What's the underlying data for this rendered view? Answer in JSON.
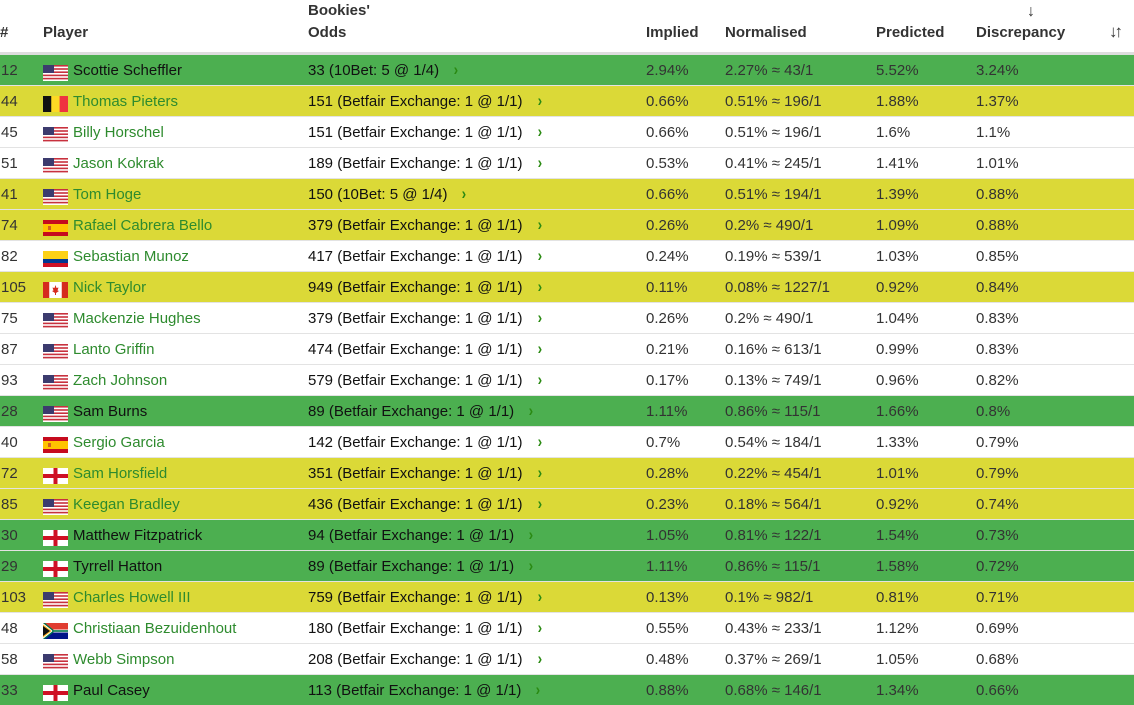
{
  "table": {
    "headers": {
      "rank": "#",
      "player": "Player",
      "odds_line1": "Bookies'",
      "odds_line2": "Odds",
      "implied": "Implied",
      "normalised": "Normalised",
      "predicted": "Predicted",
      "discrepancy": "Discrepancy",
      "sort_active_icon": "↓",
      "sort_toggle_icon": "↓↑"
    },
    "colors": {
      "green_row": "#4caf50",
      "yellow_row": "#dbd937",
      "white_row": "#ffffff",
      "link": "#2e8b2e",
      "chevron": "#2a8a12"
    },
    "chevron_icon": "›",
    "rows": [
      {
        "rank": "12",
        "flag": "usa",
        "player": "Scottie Scheffler",
        "odds": "33 (10Bet: 5 @ 1/4)",
        "implied": "2.94%",
        "normalised": "2.27% ≈ 43/1",
        "predicted": "5.52%",
        "discrepancy": "3.24%",
        "highlight": "green"
      },
      {
        "rank": "44",
        "flag": "belgium",
        "player": "Thomas Pieters",
        "odds": "151 (Betfair Exchange: 1 @ 1/1)",
        "implied": "0.66%",
        "normalised": "0.51% ≈ 196/1",
        "predicted": "1.88%",
        "discrepancy": "1.37%",
        "highlight": "yellow"
      },
      {
        "rank": "45",
        "flag": "usa",
        "player": "Billy Horschel",
        "odds": "151 (Betfair Exchange: 1 @ 1/1)",
        "implied": "0.66%",
        "normalised": "0.51% ≈ 196/1",
        "predicted": "1.6%",
        "discrepancy": "1.1%",
        "highlight": "white"
      },
      {
        "rank": "51",
        "flag": "usa",
        "player": "Jason Kokrak",
        "odds": "189 (Betfair Exchange: 1 @ 1/1)",
        "implied": "0.53%",
        "normalised": "0.41% ≈ 245/1",
        "predicted": "1.41%",
        "discrepancy": "1.01%",
        "highlight": "white"
      },
      {
        "rank": "41",
        "flag": "usa",
        "player": "Tom Hoge",
        "odds": "150 (10Bet: 5 @ 1/4)",
        "implied": "0.66%",
        "normalised": "0.51% ≈ 194/1",
        "predicted": "1.39%",
        "discrepancy": "0.88%",
        "highlight": "yellow"
      },
      {
        "rank": "74",
        "flag": "spain",
        "player": "Rafael Cabrera Bello",
        "odds": "379 (Betfair Exchange: 1 @ 1/1)",
        "implied": "0.26%",
        "normalised": "0.2% ≈ 490/1",
        "predicted": "1.09%",
        "discrepancy": "0.88%",
        "highlight": "yellow"
      },
      {
        "rank": "82",
        "flag": "colombia",
        "player": "Sebastian Munoz",
        "odds": "417 (Betfair Exchange: 1 @ 1/1)",
        "implied": "0.24%",
        "normalised": "0.19% ≈ 539/1",
        "predicted": "1.03%",
        "discrepancy": "0.85%",
        "highlight": "white"
      },
      {
        "rank": "105",
        "flag": "canada",
        "player": "Nick Taylor",
        "odds": "949 (Betfair Exchange: 1 @ 1/1)",
        "implied": "0.11%",
        "normalised": "0.08% ≈ 1227/1",
        "predicted": "0.92%",
        "discrepancy": "0.84%",
        "highlight": "yellow"
      },
      {
        "rank": "75",
        "flag": "usa",
        "player": "Mackenzie Hughes",
        "odds": "379 (Betfair Exchange: 1 @ 1/1)",
        "implied": "0.26%",
        "normalised": "0.2% ≈ 490/1",
        "predicted": "1.04%",
        "discrepancy": "0.83%",
        "highlight": "white"
      },
      {
        "rank": "87",
        "flag": "usa",
        "player": "Lanto Griffin",
        "odds": "474 (Betfair Exchange: 1 @ 1/1)",
        "implied": "0.21%",
        "normalised": "0.16% ≈ 613/1",
        "predicted": "0.99%",
        "discrepancy": "0.83%",
        "highlight": "white"
      },
      {
        "rank": "93",
        "flag": "usa",
        "player": "Zach Johnson",
        "odds": "579 (Betfair Exchange: 1 @ 1/1)",
        "implied": "0.17%",
        "normalised": "0.13% ≈ 749/1",
        "predicted": "0.96%",
        "discrepancy": "0.82%",
        "highlight": "white"
      },
      {
        "rank": "28",
        "flag": "usa",
        "player": "Sam Burns",
        "odds": "89 (Betfair Exchange: 1 @ 1/1)",
        "implied": "1.11%",
        "normalised": "0.86% ≈ 115/1",
        "predicted": "1.66%",
        "discrepancy": "0.8%",
        "highlight": "green"
      },
      {
        "rank": "40",
        "flag": "spain",
        "player": "Sergio Garcia",
        "odds": "142 (Betfair Exchange: 1 @ 1/1)",
        "implied": "0.7%",
        "normalised": "0.54% ≈ 184/1",
        "predicted": "1.33%",
        "discrepancy": "0.79%",
        "highlight": "white"
      },
      {
        "rank": "72",
        "flag": "england",
        "player": "Sam Horsfield",
        "odds": "351 (Betfair Exchange: 1 @ 1/1)",
        "implied": "0.28%",
        "normalised": "0.22% ≈ 454/1",
        "predicted": "1.01%",
        "discrepancy": "0.79%",
        "highlight": "yellow"
      },
      {
        "rank": "85",
        "flag": "usa",
        "player": "Keegan Bradley",
        "odds": "436 (Betfair Exchange: 1 @ 1/1)",
        "implied": "0.23%",
        "normalised": "0.18% ≈ 564/1",
        "predicted": "0.92%",
        "discrepancy": "0.74%",
        "highlight": "yellow"
      },
      {
        "rank": "30",
        "flag": "england",
        "player": "Matthew Fitzpatrick",
        "odds": "94 (Betfair Exchange: 1 @ 1/1)",
        "implied": "1.05%",
        "normalised": "0.81% ≈ 122/1",
        "predicted": "1.54%",
        "discrepancy": "0.73%",
        "highlight": "green"
      },
      {
        "rank": "29",
        "flag": "england",
        "player": "Tyrrell Hatton",
        "odds": "89 (Betfair Exchange: 1 @ 1/1)",
        "implied": "1.11%",
        "normalised": "0.86% ≈ 115/1",
        "predicted": "1.58%",
        "discrepancy": "0.72%",
        "highlight": "green"
      },
      {
        "rank": "103",
        "flag": "usa",
        "player": "Charles Howell III",
        "odds": "759 (Betfair Exchange: 1 @ 1/1)",
        "implied": "0.13%",
        "normalised": "0.1% ≈ 982/1",
        "predicted": "0.81%",
        "discrepancy": "0.71%",
        "highlight": "yellow"
      },
      {
        "rank": "48",
        "flag": "south-africa",
        "player": "Christiaan Bezuidenhout",
        "odds": "180 (Betfair Exchange: 1 @ 1/1)",
        "implied": "0.55%",
        "normalised": "0.43% ≈ 233/1",
        "predicted": "1.12%",
        "discrepancy": "0.69%",
        "highlight": "white"
      },
      {
        "rank": "58",
        "flag": "usa",
        "player": "Webb Simpson",
        "odds": "208 (Betfair Exchange: 1 @ 1/1)",
        "implied": "0.48%",
        "normalised": "0.37% ≈ 269/1",
        "predicted": "1.05%",
        "discrepancy": "0.68%",
        "highlight": "white"
      },
      {
        "rank": "33",
        "flag": "england",
        "player": "Paul Casey",
        "odds": "113 (Betfair Exchange: 1 @ 1/1)",
        "implied": "0.88%",
        "normalised": "0.68% ≈ 146/1",
        "predicted": "1.34%",
        "discrepancy": "0.66%",
        "highlight": "green"
      }
    ]
  }
}
